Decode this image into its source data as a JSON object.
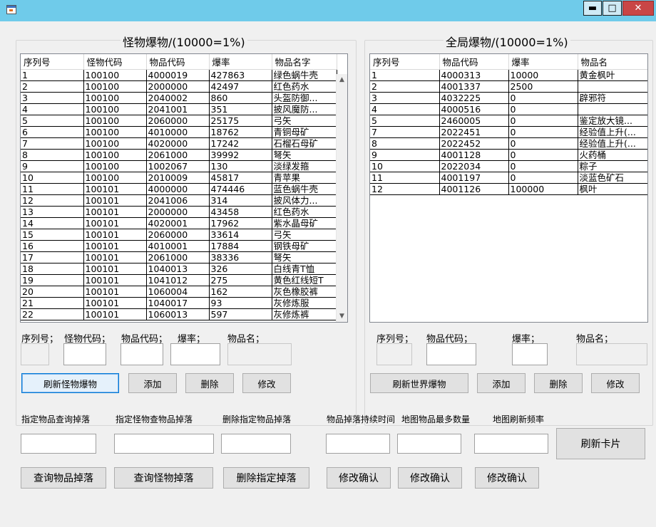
{
  "window": {
    "minimize": "▬",
    "maximize": "□",
    "close": "✕"
  },
  "left": {
    "title": "怪物爆物/(10000=1%)",
    "columns": [
      "序列号",
      "怪物代码",
      "物品代码",
      "爆率",
      "物品名字"
    ],
    "rows": [
      [
        "1",
        "100100",
        "4000019",
        "427863",
        "绿色蜗牛壳"
      ],
      [
        "2",
        "100100",
        "2000000",
        "42497",
        "红色药水"
      ],
      [
        "3",
        "100100",
        "2040002",
        "860",
        "头盔防御..."
      ],
      [
        "4",
        "100100",
        "2041001",
        "351",
        "披风魔防..."
      ],
      [
        "5",
        "100100",
        "2060000",
        "25175",
        "弓矢"
      ],
      [
        "6",
        "100100",
        "4010000",
        "18762",
        "青铜母矿"
      ],
      [
        "7",
        "100100",
        "4020000",
        "17242",
        "石榴石母矿"
      ],
      [
        "8",
        "100100",
        "2061000",
        "39992",
        "弩矢"
      ],
      [
        "9",
        "100100",
        "1002067",
        "130",
        "淡绿发箍"
      ],
      [
        "10",
        "100100",
        "2010009",
        "45817",
        "青苹果"
      ],
      [
        "11",
        "100101",
        "4000000",
        "474446",
        "蓝色蜗牛壳"
      ],
      [
        "12",
        "100101",
        "2041006",
        "314",
        "披风体力..."
      ],
      [
        "13",
        "100101",
        "2000000",
        "43458",
        "红色药水"
      ],
      [
        "14",
        "100101",
        "4020001",
        "17962",
        "紫水晶母矿"
      ],
      [
        "15",
        "100101",
        "2060000",
        "33614",
        "弓矢"
      ],
      [
        "16",
        "100101",
        "4010001",
        "17884",
        "钢铁母矿"
      ],
      [
        "17",
        "100101",
        "2061000",
        "38336",
        "弩矢"
      ],
      [
        "18",
        "100101",
        "1040013",
        "326",
        "白线青T恤"
      ],
      [
        "19",
        "100101",
        "1041012",
        "275",
        "黄色红线短T"
      ],
      [
        "20",
        "100101",
        "1060004",
        "162",
        "灰色橡胶裤"
      ],
      [
        "21",
        "100101",
        "1040017",
        "93",
        "灰修炼服"
      ],
      [
        "22",
        "100101",
        "1060013",
        "597",
        "灰修炼裤"
      ]
    ],
    "field_labels": {
      "seq": "序列号；",
      "mob": "怪物代码；",
      "item": "物品代码；",
      "rate": "爆率；",
      "name": "物品名；"
    },
    "buttons": {
      "refresh": "刷新怪物爆物",
      "add": "添加",
      "delete": "删除",
      "edit": "修改"
    }
  },
  "right": {
    "title": "全局爆物/(10000=1%)",
    "columns": [
      "序列号",
      "物品代码",
      "爆率",
      "物品名"
    ],
    "rows": [
      [
        "1",
        "4000313",
        "10000",
        "黄金枫叶"
      ],
      [
        "2",
        "4001337",
        "2500",
        ""
      ],
      [
        "3",
        "4032225",
        "0",
        "辟邪符"
      ],
      [
        "4",
        "4000516",
        "0",
        ""
      ],
      [
        "5",
        "2460005",
        "0",
        "鉴定放大镜..."
      ],
      [
        "7",
        "2022451",
        "0",
        "经验值上升(..."
      ],
      [
        "8",
        "2022452",
        "0",
        "经验值上升(..."
      ],
      [
        "9",
        "4001128",
        "0",
        "火药桶"
      ],
      [
        "10",
        "2022034",
        "0",
        "粽子"
      ],
      [
        "11",
        "4001197",
        "0",
        "淡蓝色矿石"
      ],
      [
        "12",
        "4001126",
        "100000",
        "枫叶"
      ]
    ],
    "field_labels": {
      "seq": "序列号；",
      "item": "物品代码；",
      "rate": "爆率；",
      "name": "物品名；"
    },
    "buttons": {
      "refresh": "刷新世界爆物",
      "add": "添加",
      "delete": "删除",
      "edit": "修改"
    }
  },
  "bottom": {
    "labels": {
      "query_item": "指定物品查询掉落",
      "query_mob": "指定怪物查物品掉落",
      "delete_item": "删除指定物品掉落",
      "duration": "物品掉落持续时间",
      "max_count": "地图物品最多数量",
      "refresh_rate": "地图刷新频率"
    },
    "buttons": {
      "query_item": "查询物品掉落",
      "query_mob": "查询怪物掉落",
      "delete_drop": "删除指定掉落",
      "confirm1": "修改确认",
      "confirm2": "修改确认",
      "confirm3": "修改确认",
      "refresh_card": "刷新卡片"
    }
  }
}
